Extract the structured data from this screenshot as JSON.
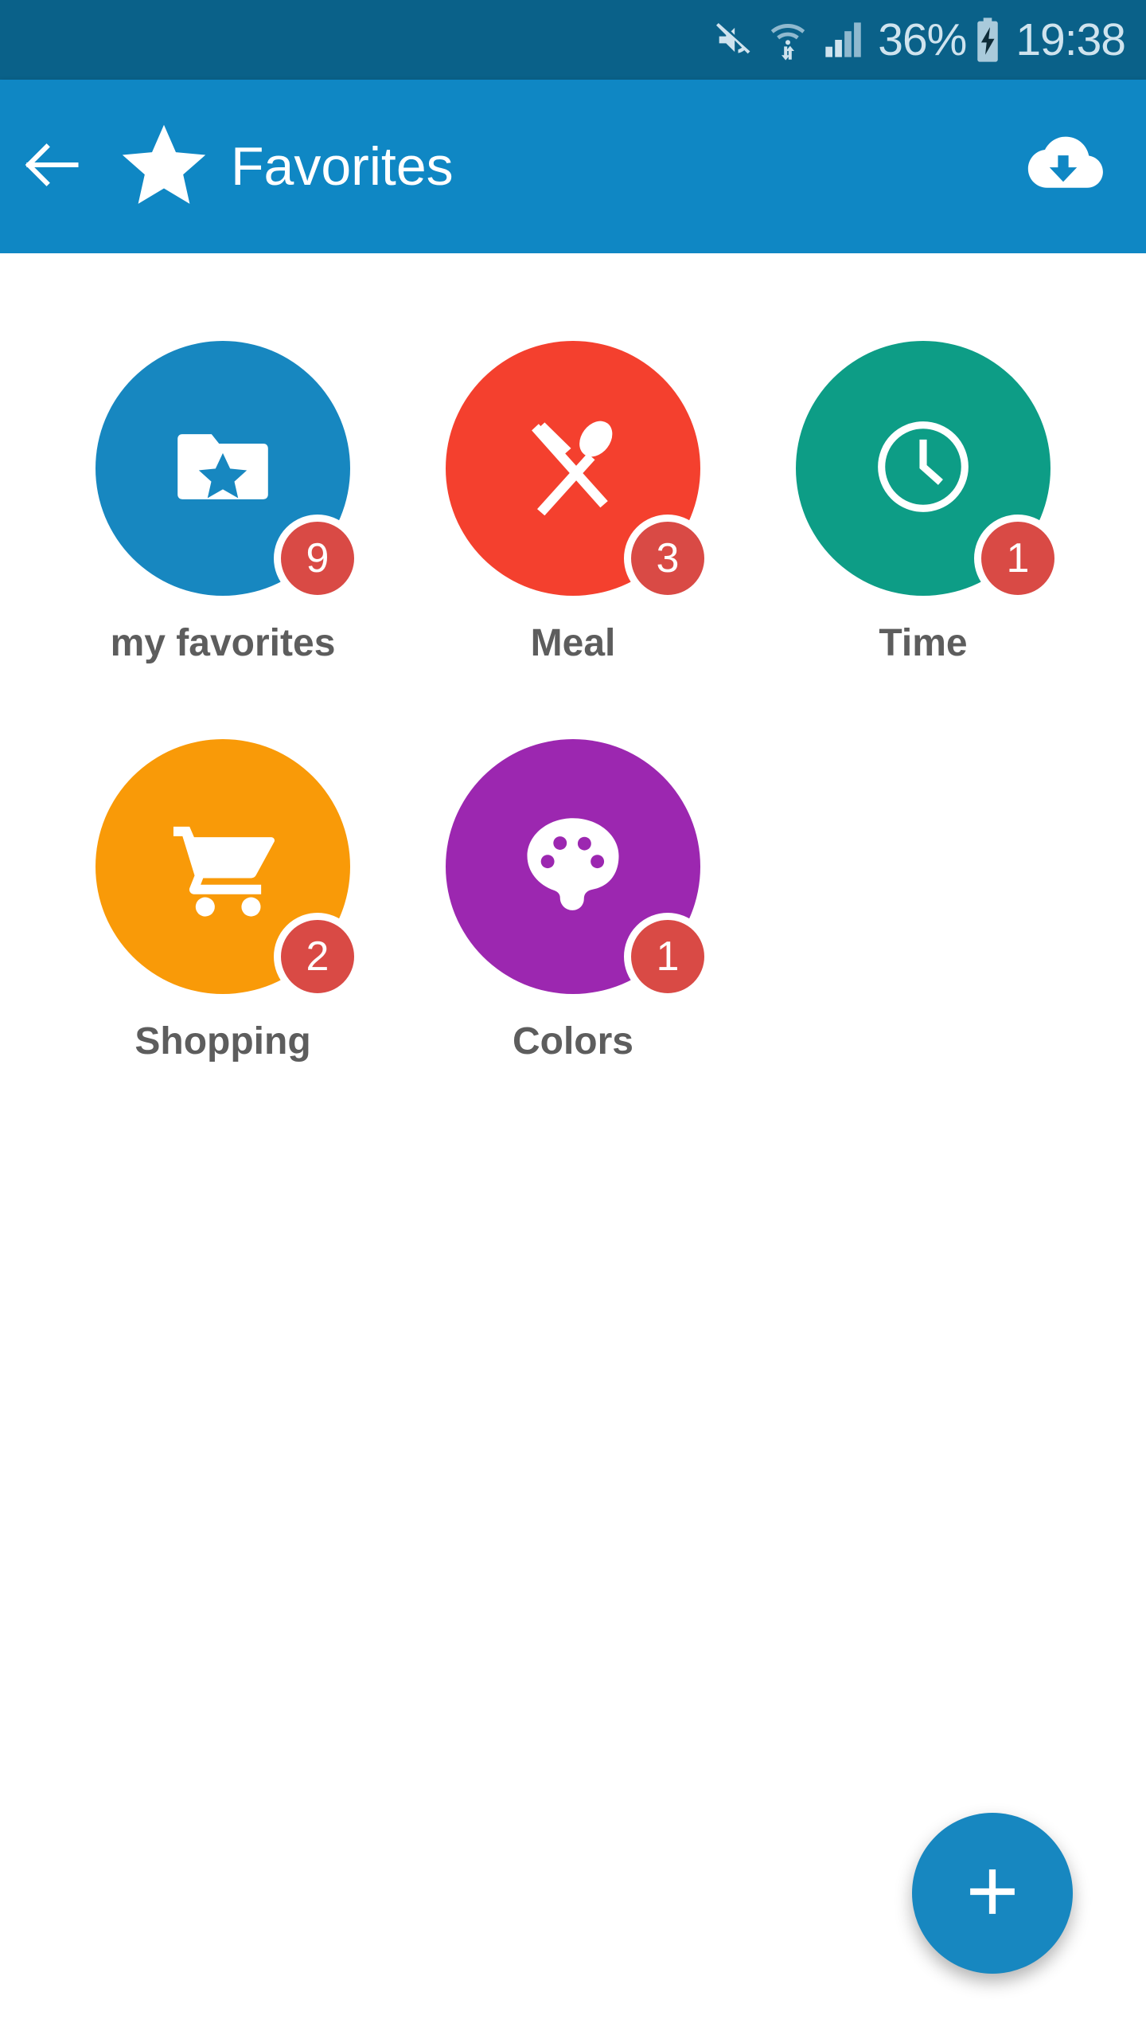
{
  "status_bar": {
    "background": "#0a6189",
    "mute_icon": "mute-icon",
    "wifi_icon": "wifi-transfer-icon",
    "signal_icon": "cellular-signal-icon",
    "battery_percent": "36%",
    "battery_icon": "battery-charging-icon",
    "clock": "19:38"
  },
  "app_bar": {
    "background": "#0f87c4",
    "back_icon": "arrow-left-icon",
    "star_icon": "star-icon",
    "title": "Favorites",
    "download_icon": "cloud-download-icon"
  },
  "grid": {
    "items": [
      {
        "label": "my favorites",
        "badge": "9",
        "color": "#1787c0",
        "badge_color": "#d94a45",
        "icon": "folder-star-icon"
      },
      {
        "label": "Meal",
        "badge": "3",
        "color": "#f4402e",
        "badge_color": "#d94a45",
        "icon": "cutlery-icon"
      },
      {
        "label": "Time",
        "badge": "1",
        "color": "#0d9d86",
        "badge_color": "#d94a45",
        "icon": "clock-icon"
      },
      {
        "label": "Shopping",
        "badge": "2",
        "color": "#f99a08",
        "badge_color": "#d94a45",
        "icon": "shopping-cart-icon"
      },
      {
        "label": "Colors",
        "badge": "1",
        "color": "#9c27b0",
        "badge_color": "#d94a45",
        "icon": "palette-icon"
      }
    ]
  },
  "fab": {
    "icon": "plus-icon",
    "color": "#1787c0"
  }
}
